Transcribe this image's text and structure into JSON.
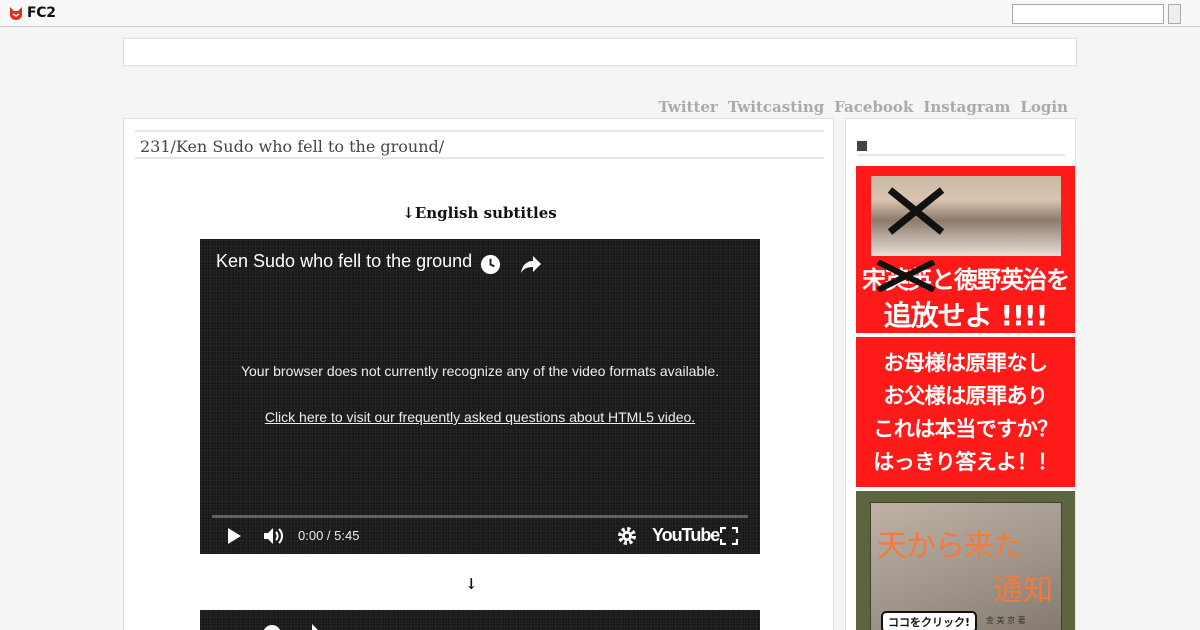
{
  "header": {
    "logo_text": "FC2",
    "search_placeholder": ""
  },
  "nav": {
    "links": [
      "Twitter",
      "Twitcasting",
      "Facebook",
      "Instagram",
      "Login"
    ]
  },
  "post": {
    "title": "231/Ken Sudo who fell to the ground/",
    "subtitle_note": "↓English subtitles",
    "arrow_note": "↓"
  },
  "video": {
    "title": "Ken Sudo who fell to the ground",
    "message": "Your browser does not currently recognize any of the video formats available.",
    "faq_link": "Click here to visit our frequently asked questions about HTML5 video.",
    "time": "0:00 / 5:45",
    "brand": "YouTube"
  },
  "sidebar": {
    "heading": "",
    "ad1": {
      "line1": "宋英英と徳野英治を",
      "line2": "追放せよ !!!!"
    },
    "ad2": {
      "lines": [
        "お母様は原罪なし",
        "お父様は原罪あり",
        "これは本当ですか？",
        "はっきり答えよ！！"
      ]
    },
    "ad3": {
      "line1": "天から来た",
      "line2": "通知",
      "button": "ココをクリック!",
      "author": "金 美 京 著"
    }
  },
  "colors": {
    "ad_red": "#ff1a1a",
    "ad3_green": "#5d6440",
    "ad3_orange": "#f47a3b",
    "nav_gray": "#aaaaaa"
  }
}
